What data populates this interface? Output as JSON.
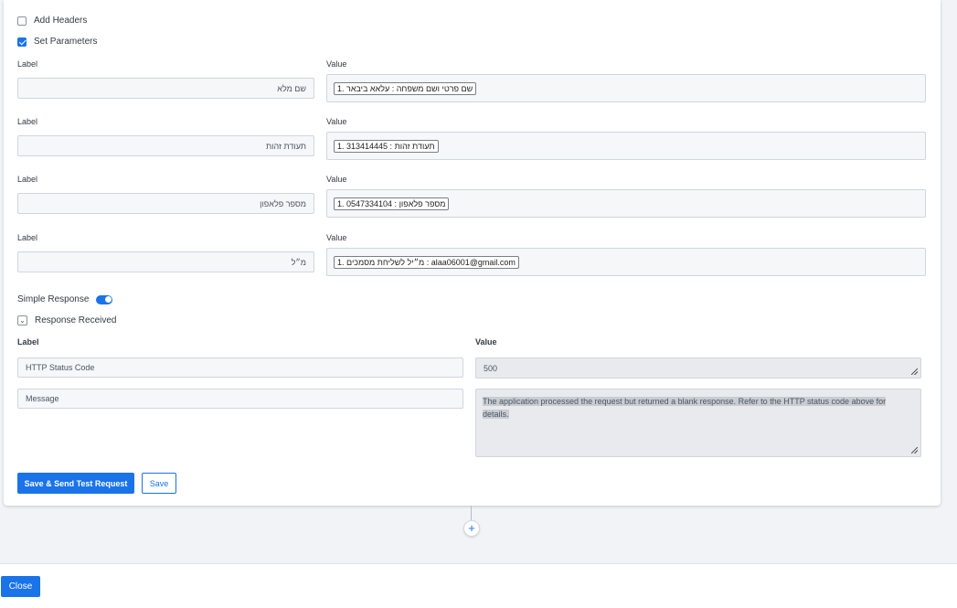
{
  "options": {
    "add_headers_label": "Add Headers",
    "set_parameters_label": "Set Parameters"
  },
  "params": {
    "label_header": "Label",
    "value_header": "Value",
    "rows": [
      {
        "label": "שם מלא",
        "value": "1. שם פרטי ושם משפחה : עלאא ביבאר"
      },
      {
        "label": "תעודת זהות",
        "value": "1. 313414445 : תעודת זהות"
      },
      {
        "label": "מספר פלאפון",
        "value": "1. 0547334104 : מספר פלאפון"
      },
      {
        "label": "מ״ל",
        "value": "1. מ״יל לשליחת מסמכים : alaa06001@gmail.com"
      }
    ]
  },
  "response": {
    "simple_response_label": "Simple Response",
    "response_received_label": "Response Received",
    "label_header": "Label",
    "value_header": "Value",
    "status_label": "HTTP Status Code",
    "status_value": "500",
    "message_label": "Message",
    "message_value": "The application processed the request but returned a blank response.  Refer to the HTTP status code above for details."
  },
  "actions": {
    "save_send_label": "Save & Send Test Request",
    "save_label": "Save",
    "add_step_symbol": "+",
    "close_label": "Close"
  },
  "colors": {
    "accent": "#1a73e8"
  }
}
